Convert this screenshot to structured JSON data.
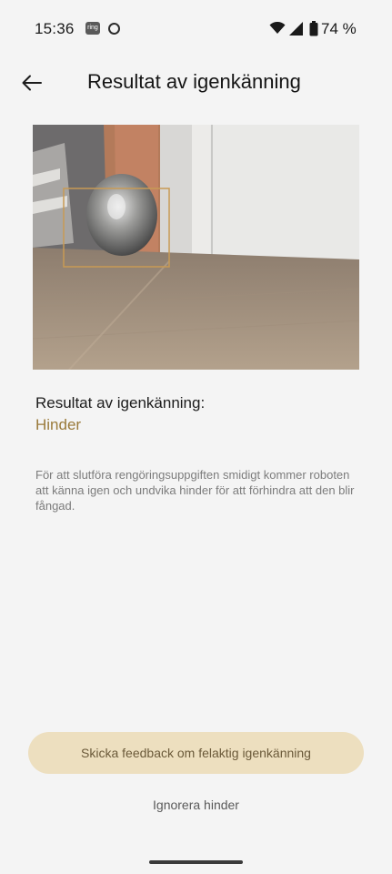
{
  "status_bar": {
    "time": "15:36",
    "notification_icons": [
      "ring-icon",
      "circle-icon"
    ],
    "right_icons": [
      "wifi-icon",
      "signal-icon",
      "battery-icon"
    ],
    "battery": "74 %",
    "ring_label": "ring"
  },
  "header": {
    "back_icon": "arrow-left-icon",
    "title": "Resultat av igenkänning"
  },
  "photo": {
    "subject": "detected-obstacle",
    "box_color": "#c89a54"
  },
  "result": {
    "label": "Resultat av igenkänning:",
    "value": "Hinder",
    "value_color": "#9a7a3a"
  },
  "description": "För att slutföra rengöringsuppgiften smidigt kommer roboten att känna igen och undvika hinder för att förhindra att den blir fångad.",
  "actions": {
    "feedback_label": "Skicka feedback om felaktig igenkänning",
    "ignore_label": "Ignorera hinder",
    "feedback_bg": "#eddfbf"
  }
}
